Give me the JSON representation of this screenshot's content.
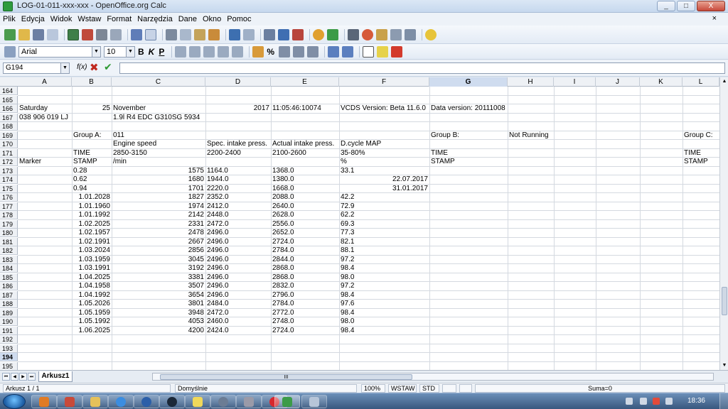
{
  "window": {
    "title": "LOG-01-011-xxx-xxx - OpenOffice.org Calc",
    "buttons": [
      "_",
      "□",
      "X"
    ]
  },
  "menu": [
    "Plik",
    "Edycja",
    "Widok",
    "Wstaw",
    "Format",
    "Narzędzia",
    "Dane",
    "Okno",
    "Pomoc"
  ],
  "menu_close": "×",
  "format_toolbar": {
    "font_name": "Arial",
    "font_size": "10",
    "bold": "B",
    "italic": "K",
    "underline": "P",
    "percent": "%"
  },
  "formula_bar": {
    "cell_ref": "G194",
    "fx_label": "f(x)",
    "cancel_icon": "✖",
    "accept_icon": "✔",
    "value": ""
  },
  "columns": [
    "A",
    "B",
    "C",
    "D",
    "E",
    "F",
    "G",
    "H",
    "I",
    "J",
    "K",
    "L"
  ],
  "selected_column": "G",
  "rows": [
    "164",
    "165",
    "166",
    "167",
    "168",
    "169",
    "170",
    "171",
    "172",
    "173",
    "174",
    "175",
    "176",
    "177",
    "178",
    "179",
    "180",
    "181",
    "182",
    "183",
    "184",
    "185",
    "186",
    "187",
    "188",
    "189",
    "190",
    "191",
    "192",
    "193",
    "194",
    "195"
  ],
  "selected_row": "194",
  "cells": [
    {
      "row": "166",
      "col": "A",
      "text": "Saturday",
      "align": "l"
    },
    {
      "row": "166",
      "col": "B",
      "text": "25",
      "align": "r"
    },
    {
      "row": "166",
      "col": "C",
      "text": "November",
      "align": "l"
    },
    {
      "row": "166",
      "col": "D",
      "text": "2017",
      "align": "r"
    },
    {
      "row": "166",
      "col": "E",
      "text": "11:05:46:10074",
      "align": "l"
    },
    {
      "row": "166",
      "col": "F",
      "text": "VCDS Version: Beta 11.6.0",
      "align": "l"
    },
    {
      "row": "166",
      "col": "G",
      "text": "Data version: 20111008",
      "align": "l"
    },
    {
      "row": "167",
      "col": "A",
      "text": "038 906 019 LJ",
      "align": "l"
    },
    {
      "row": "167",
      "col": "C",
      "text": "1.9l R4 EDC G310SG  5934",
      "align": "l"
    },
    {
      "row": "169",
      "col": "B",
      "text": "Group A:",
      "align": "l"
    },
    {
      "row": "169",
      "col": "C",
      "text": "011",
      "align": "l"
    },
    {
      "row": "169",
      "col": "G",
      "text": "Group B:",
      "align": "l"
    },
    {
      "row": "169",
      "col": "H",
      "text": "Not Running",
      "align": "l"
    },
    {
      "row": "169",
      "col": "L",
      "text": "Group C:",
      "align": "l"
    },
    {
      "row": "170",
      "col": "C",
      "text": "Engine speed",
      "align": "l"
    },
    {
      "row": "170",
      "col": "D",
      "text": "Spec. intake press.",
      "align": "l"
    },
    {
      "row": "170",
      "col": "E",
      "text": "Actual intake press.",
      "align": "l"
    },
    {
      "row": "170",
      "col": "F",
      "text": "D.cycle MAP",
      "align": "l"
    },
    {
      "row": "171",
      "col": "B",
      "text": "TIME",
      "align": "l"
    },
    {
      "row": "171",
      "col": "C",
      "text": "2850-3150",
      "align": "l"
    },
    {
      "row": "171",
      "col": "D",
      "text": "2200-2400",
      "align": "l"
    },
    {
      "row": "171",
      "col": "E",
      "text": "2100-2600",
      "align": "l"
    },
    {
      "row": "171",
      "col": "F",
      "text": "35-80%",
      "align": "l"
    },
    {
      "row": "171",
      "col": "G",
      "text": "TIME",
      "align": "l"
    },
    {
      "row": "171",
      "col": "L",
      "text": "TIME",
      "align": "l"
    },
    {
      "row": "172",
      "col": "A",
      "text": "Marker",
      "align": "l"
    },
    {
      "row": "172",
      "col": "B",
      "text": "STAMP",
      "align": "l"
    },
    {
      "row": "172",
      "col": "C",
      "text": " /min",
      "align": "l"
    },
    {
      "row": "172",
      "col": "F",
      "text": " %",
      "align": "l"
    },
    {
      "row": "172",
      "col": "G",
      "text": "STAMP",
      "align": "l"
    },
    {
      "row": "172",
      "col": "L",
      "text": "STAMP",
      "align": "l"
    },
    {
      "row": "173",
      "col": "B",
      "text": "0.28",
      "align": "l"
    },
    {
      "row": "173",
      "col": "C",
      "text": "1575",
      "align": "r"
    },
    {
      "row": "173",
      "col": "D",
      "text": "1164.0",
      "align": "l"
    },
    {
      "row": "173",
      "col": "E",
      "text": "1368.0",
      "align": "l"
    },
    {
      "row": "173",
      "col": "F",
      "text": "33.1",
      "align": "l"
    },
    {
      "row": "174",
      "col": "B",
      "text": "0.62",
      "align": "l"
    },
    {
      "row": "174",
      "col": "C",
      "text": "1680",
      "align": "r"
    },
    {
      "row": "174",
      "col": "D",
      "text": "1944.0",
      "align": "l"
    },
    {
      "row": "174",
      "col": "E",
      "text": "1380.0",
      "align": "l"
    },
    {
      "row": "174",
      "col": "F",
      "text": "22.07.2017",
      "align": "r"
    },
    {
      "row": "175",
      "col": "B",
      "text": "0.94",
      "align": "l"
    },
    {
      "row": "175",
      "col": "C",
      "text": "1701",
      "align": "r"
    },
    {
      "row": "175",
      "col": "D",
      "text": "2220.0",
      "align": "l"
    },
    {
      "row": "175",
      "col": "E",
      "text": "1668.0",
      "align": "l"
    },
    {
      "row": "175",
      "col": "F",
      "text": "31.01.2017",
      "align": "r"
    },
    {
      "row": "176",
      "col": "B",
      "text": "1.01.2028",
      "align": "r"
    },
    {
      "row": "176",
      "col": "C",
      "text": "1827",
      "align": "r"
    },
    {
      "row": "176",
      "col": "D",
      "text": "2352.0",
      "align": "l"
    },
    {
      "row": "176",
      "col": "E",
      "text": "2088.0",
      "align": "l"
    },
    {
      "row": "176",
      "col": "F",
      "text": "42.2",
      "align": "l"
    },
    {
      "row": "177",
      "col": "B",
      "text": "1.01.1960",
      "align": "r"
    },
    {
      "row": "177",
      "col": "C",
      "text": "1974",
      "align": "r"
    },
    {
      "row": "177",
      "col": "D",
      "text": "2412.0",
      "align": "l"
    },
    {
      "row": "177",
      "col": "E",
      "text": "2640.0",
      "align": "l"
    },
    {
      "row": "177",
      "col": "F",
      "text": "72.9",
      "align": "l"
    },
    {
      "row": "178",
      "col": "B",
      "text": "1.01.1992",
      "align": "r"
    },
    {
      "row": "178",
      "col": "C",
      "text": "2142",
      "align": "r"
    },
    {
      "row": "178",
      "col": "D",
      "text": "2448.0",
      "align": "l"
    },
    {
      "row": "178",
      "col": "E",
      "text": "2628.0",
      "align": "l"
    },
    {
      "row": "178",
      "col": "F",
      "text": "62.2",
      "align": "l"
    },
    {
      "row": "179",
      "col": "B",
      "text": "1.02.2025",
      "align": "r"
    },
    {
      "row": "179",
      "col": "C",
      "text": "2331",
      "align": "r"
    },
    {
      "row": "179",
      "col": "D",
      "text": "2472.0",
      "align": "l"
    },
    {
      "row": "179",
      "col": "E",
      "text": "2556.0",
      "align": "l"
    },
    {
      "row": "179",
      "col": "F",
      "text": "69.3",
      "align": "l"
    },
    {
      "row": "180",
      "col": "B",
      "text": "1.02.1957",
      "align": "r"
    },
    {
      "row": "180",
      "col": "C",
      "text": "2478",
      "align": "r"
    },
    {
      "row": "180",
      "col": "D",
      "text": "2496.0",
      "align": "l"
    },
    {
      "row": "180",
      "col": "E",
      "text": "2652.0",
      "align": "l"
    },
    {
      "row": "180",
      "col": "F",
      "text": "77.3",
      "align": "l"
    },
    {
      "row": "181",
      "col": "B",
      "text": "1.02.1991",
      "align": "r"
    },
    {
      "row": "181",
      "col": "C",
      "text": "2667",
      "align": "r"
    },
    {
      "row": "181",
      "col": "D",
      "text": "2496.0",
      "align": "l"
    },
    {
      "row": "181",
      "col": "E",
      "text": "2724.0",
      "align": "l"
    },
    {
      "row": "181",
      "col": "F",
      "text": "82.1",
      "align": "l"
    },
    {
      "row": "182",
      "col": "B",
      "text": "1.03.2024",
      "align": "r"
    },
    {
      "row": "182",
      "col": "C",
      "text": "2856",
      "align": "r"
    },
    {
      "row": "182",
      "col": "D",
      "text": "2496.0",
      "align": "l"
    },
    {
      "row": "182",
      "col": "E",
      "text": "2784.0",
      "align": "l"
    },
    {
      "row": "182",
      "col": "F",
      "text": "88.1",
      "align": "l"
    },
    {
      "row": "183",
      "col": "B",
      "text": "1.03.1959",
      "align": "r"
    },
    {
      "row": "183",
      "col": "C",
      "text": "3045",
      "align": "r"
    },
    {
      "row": "183",
      "col": "D",
      "text": "2496.0",
      "align": "l"
    },
    {
      "row": "183",
      "col": "E",
      "text": "2844.0",
      "align": "l"
    },
    {
      "row": "183",
      "col": "F",
      "text": "97.2",
      "align": "l"
    },
    {
      "row": "184",
      "col": "B",
      "text": "1.03.1991",
      "align": "r"
    },
    {
      "row": "184",
      "col": "C",
      "text": "3192",
      "align": "r"
    },
    {
      "row": "184",
      "col": "D",
      "text": "2496.0",
      "align": "l"
    },
    {
      "row": "184",
      "col": "E",
      "text": "2868.0",
      "align": "l"
    },
    {
      "row": "184",
      "col": "F",
      "text": "98.4",
      "align": "l"
    },
    {
      "row": "185",
      "col": "B",
      "text": "1.04.2025",
      "align": "r"
    },
    {
      "row": "185",
      "col": "C",
      "text": "3381",
      "align": "r"
    },
    {
      "row": "185",
      "col": "D",
      "text": "2496.0",
      "align": "l"
    },
    {
      "row": "185",
      "col": "E",
      "text": "2868.0",
      "align": "l"
    },
    {
      "row": "185",
      "col": "F",
      "text": "98.0",
      "align": "l"
    },
    {
      "row": "186",
      "col": "B",
      "text": "1.04.1958",
      "align": "r"
    },
    {
      "row": "186",
      "col": "C",
      "text": "3507",
      "align": "r"
    },
    {
      "row": "186",
      "col": "D",
      "text": "2496.0",
      "align": "l"
    },
    {
      "row": "186",
      "col": "E",
      "text": "2832.0",
      "align": "l"
    },
    {
      "row": "186",
      "col": "F",
      "text": "97.2",
      "align": "l"
    },
    {
      "row": "187",
      "col": "B",
      "text": "1.04.1992",
      "align": "r"
    },
    {
      "row": "187",
      "col": "C",
      "text": "3654",
      "align": "r"
    },
    {
      "row": "187",
      "col": "D",
      "text": "2496.0",
      "align": "l"
    },
    {
      "row": "187",
      "col": "E",
      "text": "2796.0",
      "align": "l"
    },
    {
      "row": "187",
      "col": "F",
      "text": "98.4",
      "align": "l"
    },
    {
      "row": "188",
      "col": "B",
      "text": "1.05.2026",
      "align": "r"
    },
    {
      "row": "188",
      "col": "C",
      "text": "3801",
      "align": "r"
    },
    {
      "row": "188",
      "col": "D",
      "text": "2484.0",
      "align": "l"
    },
    {
      "row": "188",
      "col": "E",
      "text": "2784.0",
      "align": "l"
    },
    {
      "row": "188",
      "col": "F",
      "text": "97.6",
      "align": "l"
    },
    {
      "row": "189",
      "col": "B",
      "text": "1.05.1959",
      "align": "r"
    },
    {
      "row": "189",
      "col": "C",
      "text": "3948",
      "align": "r"
    },
    {
      "row": "189",
      "col": "D",
      "text": "2472.0",
      "align": "l"
    },
    {
      "row": "189",
      "col": "E",
      "text": "2772.0",
      "align": "l"
    },
    {
      "row": "189",
      "col": "F",
      "text": "98.4",
      "align": "l"
    },
    {
      "row": "190",
      "col": "B",
      "text": "1.05.1992",
      "align": "r"
    },
    {
      "row": "190",
      "col": "C",
      "text": "4053",
      "align": "r"
    },
    {
      "row": "190",
      "col": "D",
      "text": "2460.0",
      "align": "l"
    },
    {
      "row": "190",
      "col": "E",
      "text": "2748.0",
      "align": "l"
    },
    {
      "row": "190",
      "col": "F",
      "text": "98.0",
      "align": "l"
    },
    {
      "row": "191",
      "col": "B",
      "text": "1.06.2025",
      "align": "r"
    },
    {
      "row": "191",
      "col": "C",
      "text": "4200",
      "align": "r"
    },
    {
      "row": "191",
      "col": "D",
      "text": "2424.0",
      "align": "l"
    },
    {
      "row": "191",
      "col": "E",
      "text": "2724.0",
      "align": "l"
    },
    {
      "row": "191",
      "col": "F",
      "text": "98.4",
      "align": "l"
    }
  ],
  "sheet_tabs": [
    "Arkusz1"
  ],
  "scroll_grip": "III",
  "status": {
    "sheet": "Arkusz 1 / 1",
    "style": "Domyślnie",
    "zoom": "100%",
    "insert_mode": "WSTAW",
    "selection_mode": "STD",
    "sum": "Suma=0"
  },
  "taskbar": {
    "time": "18:36"
  }
}
